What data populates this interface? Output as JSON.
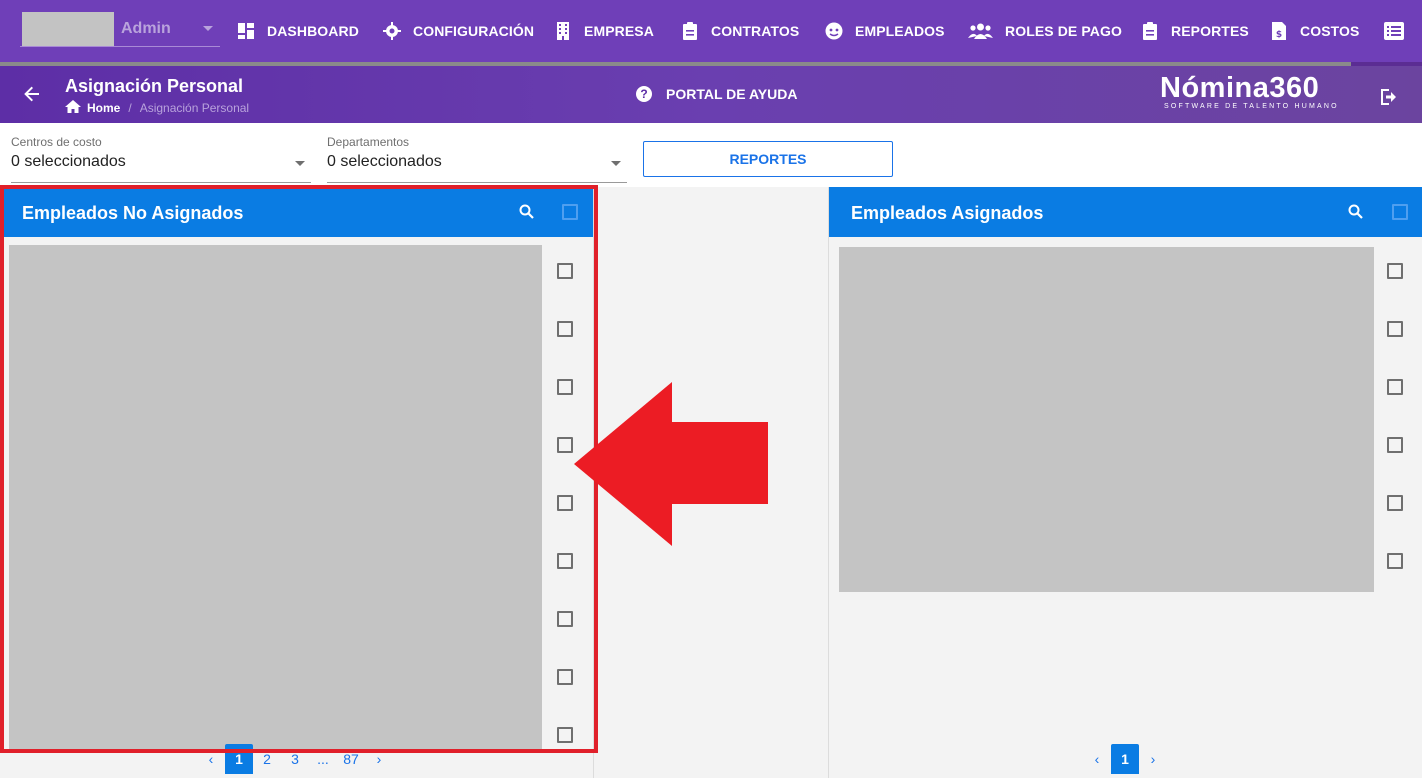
{
  "user": {
    "name": "Admin"
  },
  "nav": {
    "items": [
      {
        "id": "dashboard",
        "label": "DASHBOARD",
        "icon": "dashboard-icon"
      },
      {
        "id": "configuracion",
        "label": "CONFIGURACIÓN",
        "icon": "gear-icon"
      },
      {
        "id": "empresa",
        "label": "EMPRESA",
        "icon": "building-icon"
      },
      {
        "id": "contratos",
        "label": "CONTRATOS",
        "icon": "clipboard-icon"
      },
      {
        "id": "empleados",
        "label": "EMPLEADOS",
        "icon": "face-icon"
      },
      {
        "id": "roles",
        "label": "ROLES DE PAGO",
        "icon": "people-icon"
      },
      {
        "id": "reportes",
        "label": "REPORTES",
        "icon": "clipboard-icon"
      },
      {
        "id": "costos",
        "label": "COSTOS",
        "icon": "invoice-icon"
      },
      {
        "id": "more",
        "label": "",
        "icon": "list-icon"
      }
    ],
    "scroll_progress": 0.95
  },
  "header": {
    "title": "Asignación Personal",
    "breadcrumb_home": "Home",
    "breadcrumb_separator": "/",
    "breadcrumb_current": "Asignación Personal",
    "help_label": "PORTAL DE AYUDA",
    "brand_name": "Nómina360",
    "brand_tagline": "SOFTWARE DE TALENTO HUMANO"
  },
  "filters": {
    "cost_centers_label": "Centros de costo",
    "cost_centers_value": "0 seleccionados",
    "departments_label": "Departamentos",
    "departments_value": "0 seleccionados",
    "reports_button": "REPORTES"
  },
  "left_panel": {
    "title": "Empleados No Asignados",
    "row_count": 9,
    "pagination": [
      "1",
      "2",
      "3",
      "...",
      "87"
    ],
    "current_page": "1"
  },
  "right_panel": {
    "title": "Empleados Asignados",
    "row_count": 6,
    "pagination": [
      "1"
    ],
    "current_page": "1"
  },
  "colors": {
    "nav_bg": "#6f3fb8",
    "panel_header": "#0a7ce3",
    "highlight": "#e0202a",
    "arrow": "#ec1c24",
    "link": "#1a73e8"
  }
}
